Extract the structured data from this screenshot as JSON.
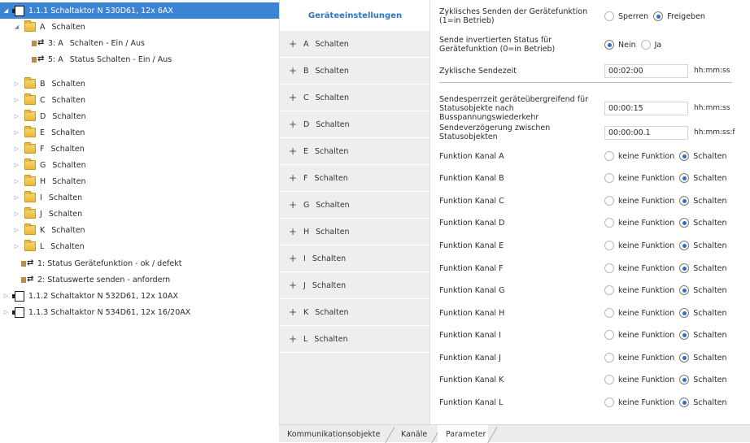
{
  "tree": {
    "devices": [
      {
        "label": "1.1.1 Schaltaktor N 530D61, 12x 6AX",
        "expanded": true
      },
      {
        "label": "1.1.2 Schaltaktor N 532D61, 12x 10AX",
        "expanded": false
      },
      {
        "label": "1.1.3 Schaltaktor N 534D61, 12x 16/20AX",
        "expanded": false
      }
    ],
    "channel_a": {
      "letter": "A",
      "label": "Schalten",
      "objects": [
        {
          "id": "3: A",
          "label": "Schalten - Ein / Aus"
        },
        {
          "id": "5: A",
          "label": "Status Schalten - Ein / Aus"
        }
      ]
    },
    "folders": [
      {
        "letter": "B",
        "label": "Schalten"
      },
      {
        "letter": "C",
        "label": "Schalten"
      },
      {
        "letter": "D",
        "label": "Schalten"
      },
      {
        "letter": "E",
        "label": "Schalten"
      },
      {
        "letter": "F",
        "label": "Schalten"
      },
      {
        "letter": "G",
        "label": "Schalten"
      },
      {
        "letter": "H",
        "label": "Schalten"
      },
      {
        "letter": "I",
        "label": "Schalten"
      },
      {
        "letter": "J",
        "label": "Schalten"
      },
      {
        "letter": "K",
        "label": "Schalten"
      },
      {
        "letter": "L",
        "label": "Schalten"
      }
    ],
    "device_objects": [
      {
        "label": "1: Status Gerätefunktion - ok / defekt"
      },
      {
        "label": "2: Statuswerte senden - anfordern"
      }
    ]
  },
  "channels_panel": {
    "header": "Geräteeinstellungen",
    "items": [
      {
        "letter": "A",
        "label": "Schalten"
      },
      {
        "letter": "B",
        "label": "Schalten"
      },
      {
        "letter": "C",
        "label": "Schalten"
      },
      {
        "letter": "D",
        "label": "Schalten"
      },
      {
        "letter": "E",
        "label": "Schalten"
      },
      {
        "letter": "F",
        "label": "Schalten"
      },
      {
        "letter": "G",
        "label": "Schalten"
      },
      {
        "letter": "H",
        "label": "Schalten"
      },
      {
        "letter": "I",
        "label": "Schalten"
      },
      {
        "letter": "J",
        "label": "Schalten"
      },
      {
        "letter": "K",
        "label": "Schalten"
      },
      {
        "letter": "L",
        "label": "Schalten"
      }
    ]
  },
  "params": {
    "cyclic_send": {
      "label": "Zyklisches Senden der Gerätefunktion (1=in Betrieb)",
      "options": [
        "Sperren",
        "Freigeben"
      ],
      "selected": 1
    },
    "inverted_status": {
      "label": "Sende invertierten Status für Gerätefunktion (0=in Betrieb)",
      "options": [
        "Nein",
        "Ja"
      ],
      "selected": 0
    },
    "cyclic_time": {
      "label": "Zyklische Sendezeit",
      "value": "00:02:00",
      "unit": "hh:mm:ss"
    },
    "send_lock": {
      "label": "Sendesperrzeit geräteübergreifend für Statusobjekte nach Busspannungswiederkehr",
      "value": "00:00:15",
      "unit": "hh:mm:ss"
    },
    "send_delay": {
      "label": "Sendeverzögerung zwischen Statusobjekten",
      "value": "00:00:00.1",
      "unit": "hh:mm:ss:f"
    },
    "function_options": [
      "keine Funktion",
      "Schalten"
    ],
    "functions": [
      {
        "label": "Funktion Kanal A",
        "selected": 1
      },
      {
        "label": "Funktion Kanal B",
        "selected": 1
      },
      {
        "label": "Funktion Kanal C",
        "selected": 1
      },
      {
        "label": "Funktion Kanal D",
        "selected": 1
      },
      {
        "label": "Funktion Kanal E",
        "selected": 1
      },
      {
        "label": "Funktion Kanal F",
        "selected": 1
      },
      {
        "label": "Funktion Kanal G",
        "selected": 1
      },
      {
        "label": "Funktion Kanal H",
        "selected": 1
      },
      {
        "label": "Funktion Kanal I",
        "selected": 1
      },
      {
        "label": "Funktion Kanal J",
        "selected": 1
      },
      {
        "label": "Funktion Kanal K",
        "selected": 1
      },
      {
        "label": "Funktion Kanal L",
        "selected": 1
      }
    ]
  },
  "tabs": {
    "items": [
      "Kommunikationsobjekte",
      "Kanäle",
      "Parameter"
    ],
    "active": 2
  },
  "colors": {
    "selection": "#3b84d4",
    "accent": "#2d73c3",
    "radio_dot": "#2b6fcf",
    "panel_bg": "#eeeeee"
  }
}
